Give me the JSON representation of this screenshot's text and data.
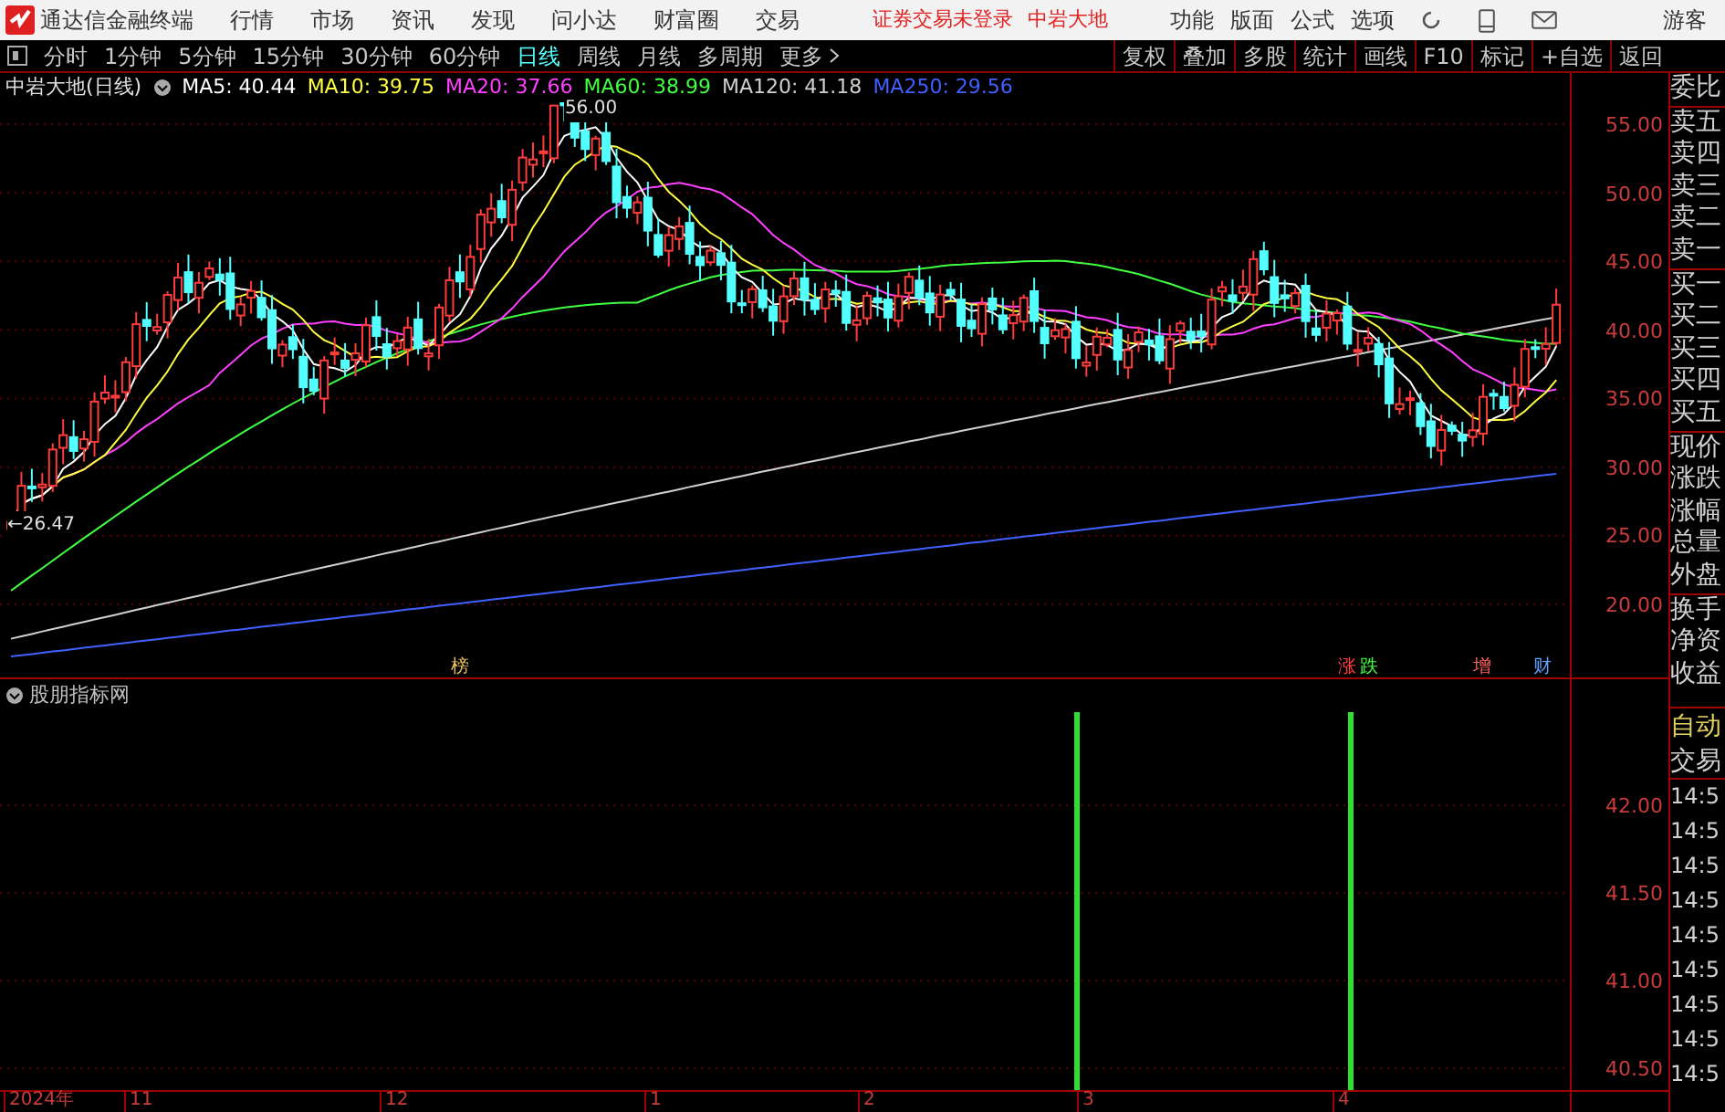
{
  "menu_bar": {
    "app_title": "通达信金融终端",
    "items": [
      "行情",
      "市场",
      "资讯",
      "发现",
      "问小达",
      "财富圈",
      "交易"
    ],
    "notice": "证券交易未登录",
    "stock_link": "中岩大地",
    "tools": [
      "功能",
      "版面",
      "公式",
      "选项"
    ],
    "user": "游客"
  },
  "period_tabs": [
    {
      "label": "分时",
      "selected": false
    },
    {
      "label": "1分钟",
      "selected": false
    },
    {
      "label": "5分钟",
      "selected": false
    },
    {
      "label": "15分钟",
      "selected": false
    },
    {
      "label": "30分钟",
      "selected": false
    },
    {
      "label": "60分钟",
      "selected": false
    },
    {
      "label": "日线",
      "selected": true
    },
    {
      "label": "周线",
      "selected": false
    },
    {
      "label": "月线",
      "selected": false
    },
    {
      "label": "多周期",
      "selected": false
    },
    {
      "label": "更多",
      "selected": false
    }
  ],
  "actions": [
    "复权",
    "叠加",
    "多股",
    "统计",
    "画线",
    "F10",
    "标记",
    "+自选",
    "返回"
  ],
  "chart": {
    "title": "中岩大地(日线)",
    "indicators": [
      {
        "label": "MA5: 40.44",
        "color": "#ffffff"
      },
      {
        "label": "MA10: 39.75",
        "color": "#ffff40"
      },
      {
        "label": "MA20: 37.66",
        "color": "#ff40ff"
      },
      {
        "label": "MA60: 38.99",
        "color": "#40ff40"
      },
      {
        "label": "MA120: 41.18",
        "color": "#d0d0d0"
      },
      {
        "label": "MA250: 29.56",
        "color": "#4060ff"
      }
    ],
    "high_label": "56.00",
    "low_label": "←26.47",
    "y_axis": [
      "55.00",
      "50.00",
      "45.00",
      "40.00",
      "35.00",
      "30.00",
      "25.00",
      "20.00"
    ],
    "markers": [
      {
        "text": "榜",
        "color": "#e8c060"
      },
      {
        "text": "涨",
        "color": "#ff4040"
      },
      {
        "text": "跌",
        "color": "#40ff40"
      },
      {
        "text": "增",
        "color": "#ff6060"
      },
      {
        "text": "财",
        "color": "#60a0ff"
      }
    ]
  },
  "sub_panel": {
    "title": "股朋指标网",
    "y_axis": [
      "42.00",
      "41.50",
      "41.00",
      "40.50"
    ]
  },
  "time_axis": [
    "2024年",
    "11",
    "12",
    "1",
    "2",
    "3",
    "4"
  ],
  "quote_panel": {
    "groups": [
      [
        "委比"
      ],
      [
        "卖五",
        "卖四",
        "卖三",
        "卖二",
        "卖一"
      ],
      [
        "买一",
        "买二",
        "买三",
        "买四",
        "买五"
      ],
      [
        "现价",
        "涨跌",
        "涨幅",
        "总量",
        "外盘"
      ],
      [
        "换手",
        "净资",
        "收益"
      ]
    ],
    "mode": "自动",
    "trade": "交易",
    "times": [
      "14:5",
      "14:5",
      "14:5",
      "14:5",
      "14:5",
      "14:5",
      "14:5",
      "14:5",
      "14:5"
    ]
  }
}
